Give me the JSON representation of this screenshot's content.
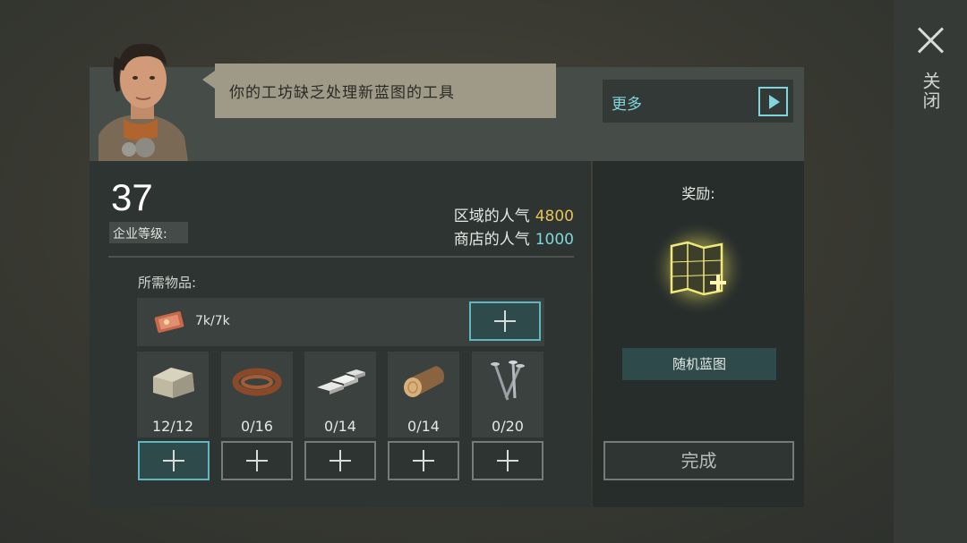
{
  "close": {
    "label": "关闭"
  },
  "npc": {
    "message": "你的工坊缺乏处理新蓝图的工具",
    "more_label": "更多"
  },
  "enterprise": {
    "level": "37",
    "level_label": "企业等级:"
  },
  "popularity": {
    "region_label": "区域的人气",
    "region_value": "4800",
    "store_label": "商店的人气",
    "store_value": "1000"
  },
  "requirements": {
    "label": "所需物品:",
    "money": {
      "icon": "ticket-icon",
      "count": "7k/7k"
    },
    "materials": [
      {
        "icon": "stone-icon",
        "count": "12/12"
      },
      {
        "icon": "leather-strap-icon",
        "count": "0/16"
      },
      {
        "icon": "metal-ingot-icon",
        "count": "0/14"
      },
      {
        "icon": "wood-log-icon",
        "count": "0/14"
      },
      {
        "icon": "nails-icon",
        "count": "0/20"
      }
    ]
  },
  "reward": {
    "label": "奖励:",
    "item_label": "随机蓝图",
    "complete_label": "完成"
  },
  "colors": {
    "accent_cyan": "#7fd6dc",
    "accent_gold": "#e6c35a",
    "speech_bg": "#9f9a88"
  }
}
